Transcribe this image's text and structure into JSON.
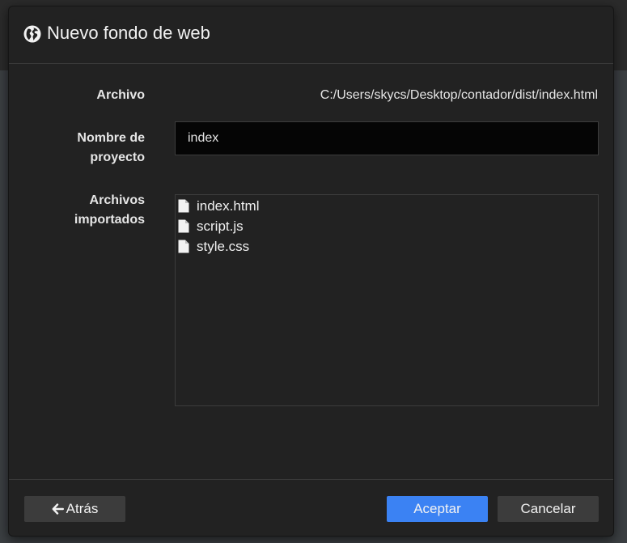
{
  "dialog": {
    "title": "Nuevo fondo de web",
    "title_icon": "globe-icon"
  },
  "form": {
    "archivo_label": "Archivo",
    "archivo_value": "C:/Users/skycs/Desktop/contador/dist/index.html",
    "nombre_label_line1": "Nombre de",
    "nombre_label_line2": "proyecto",
    "nombre_value": "index",
    "importados_label_line1": "Archivos",
    "importados_label_line2": "importados",
    "files": [
      {
        "name": "index.html",
        "icon": "file-icon"
      },
      {
        "name": "script.js",
        "icon": "file-icon"
      },
      {
        "name": "style.css",
        "icon": "file-icon"
      }
    ]
  },
  "footer": {
    "back_label": "Atrás",
    "back_icon": "arrow-left-icon",
    "accept_label": "Aceptar",
    "cancel_label": "Cancelar"
  },
  "colors": {
    "accent": "#3b82f3",
    "dialog_bg": "#222222",
    "input_bg": "#050505",
    "button_bg": "#3c3c3c"
  }
}
